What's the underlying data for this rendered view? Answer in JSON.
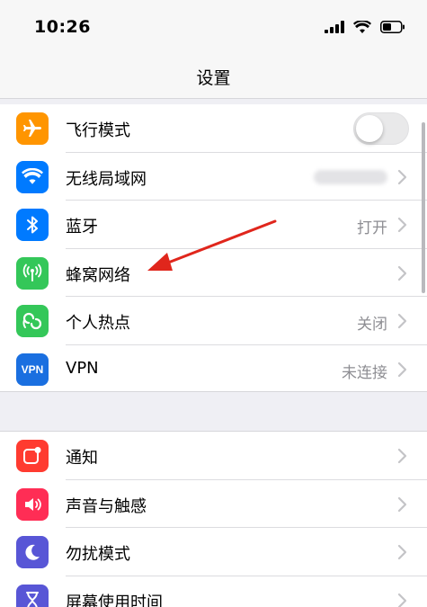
{
  "status_bar": {
    "time": "10:26",
    "icons": [
      "cellular-signal-icon",
      "wifi-icon",
      "battery-icon"
    ]
  },
  "nav": {
    "title": "设置"
  },
  "colors": {
    "airplane": "#ff9500",
    "wifi": "#007aff",
    "bluetooth": "#007aff",
    "cellular": "#34c759",
    "hotspot": "#34c759",
    "vpn": "#1a6fe0",
    "notifications": "#ff3b30",
    "sounds": "#ff2d55",
    "dnd": "#5856d6",
    "screen_time": "#5856d6",
    "annotation_arrow": "#e0261c"
  },
  "group1": {
    "items": [
      {
        "label": "飞行模式",
        "icon": "airplane-icon",
        "control": "toggle",
        "toggle_on": false
      },
      {
        "label": "无线局域网",
        "icon": "wifi-icon",
        "detail": ""
      },
      {
        "label": "蓝牙",
        "icon": "bluetooth-icon",
        "detail": "打开"
      },
      {
        "label": "蜂窝网络",
        "icon": "cellular-icon",
        "detail": ""
      },
      {
        "label": "个人热点",
        "icon": "hotspot-icon",
        "detail": "关闭"
      },
      {
        "label": "VPN",
        "icon": "vpn-icon",
        "icon_text": "VPN",
        "detail": "未连接"
      }
    ]
  },
  "group2": {
    "items": [
      {
        "label": "通知",
        "icon": "notifications-icon"
      },
      {
        "label": "声音与触感",
        "icon": "sound-icon"
      },
      {
        "label": "勿扰模式",
        "icon": "moon-icon"
      },
      {
        "label": "屏幕使用时间",
        "icon": "hourglass-icon"
      }
    ]
  }
}
